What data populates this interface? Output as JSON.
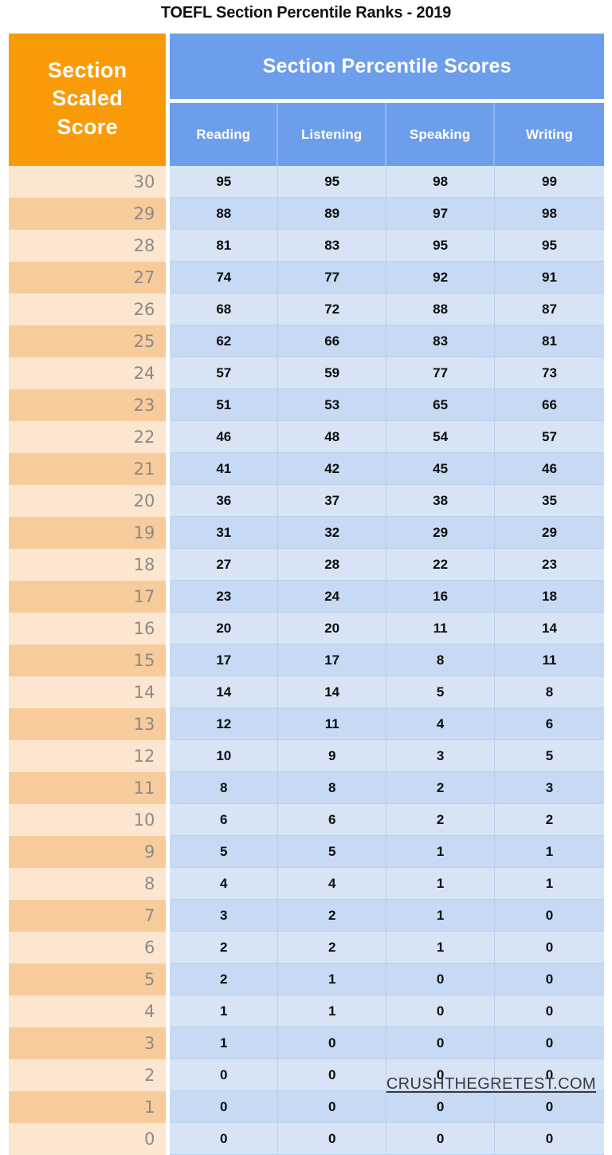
{
  "title": "TOEFL Section Percentile Ranks - 2019",
  "header": {
    "scaled_label": "Section Scaled Score",
    "scaled_line1": "Section",
    "scaled_line2": "Scaled",
    "scaled_line3": "Score",
    "group_label": "Section Percentile Scores",
    "columns": [
      "Reading",
      "Listening",
      "Speaking",
      "Writing"
    ]
  },
  "footer": {
    "watermark": "CRUSHTHEGRETEST.COM"
  },
  "colors": {
    "orange_header": "#F99B08",
    "blue_header": "#6D9EEB",
    "orange_band_light": "#FCE6CF",
    "orange_band_dark": "#F8CB9C",
    "blue_band_light": "#D6E4F5",
    "blue_band_dark": "#C7D9F3",
    "title_text": "#111111",
    "scaled_text": "#8A8A8A",
    "score_text": "#0D0D0D"
  },
  "chart_data": {
    "type": "table",
    "title": "TOEFL Section Percentile Ranks - 2019",
    "xlabel": "Section Scaled Score",
    "ylabel": "Section Percentile Scores",
    "categories": [
      "Reading",
      "Listening",
      "Speaking",
      "Writing"
    ],
    "x": [
      30,
      29,
      28,
      27,
      26,
      25,
      24,
      23,
      22,
      21,
      20,
      19,
      18,
      17,
      16,
      15,
      14,
      13,
      12,
      11,
      10,
      9,
      8,
      7,
      6,
      5,
      4,
      3,
      2,
      1,
      0
    ],
    "series": [
      {
        "name": "Reading",
        "values": [
          95,
          88,
          81,
          74,
          68,
          62,
          57,
          51,
          46,
          41,
          36,
          31,
          27,
          23,
          20,
          17,
          14,
          12,
          10,
          8,
          6,
          5,
          4,
          3,
          2,
          2,
          1,
          1,
          0,
          0,
          0
        ]
      },
      {
        "name": "Listening",
        "values": [
          95,
          89,
          83,
          77,
          72,
          66,
          59,
          53,
          48,
          42,
          37,
          32,
          28,
          24,
          20,
          17,
          14,
          11,
          9,
          8,
          6,
          5,
          4,
          2,
          2,
          1,
          1,
          0,
          0,
          0,
          0
        ]
      },
      {
        "name": "Speaking",
        "values": [
          98,
          97,
          95,
          92,
          88,
          83,
          77,
          65,
          54,
          45,
          38,
          29,
          22,
          16,
          11,
          8,
          5,
          4,
          3,
          2,
          2,
          1,
          1,
          1,
          1,
          0,
          0,
          0,
          0,
          0,
          0
        ]
      },
      {
        "name": "Writing",
        "values": [
          99,
          98,
          95,
          91,
          87,
          81,
          73,
          66,
          57,
          46,
          35,
          29,
          23,
          18,
          14,
          11,
          8,
          6,
          5,
          3,
          2,
          1,
          1,
          0,
          0,
          0,
          0,
          0,
          0,
          0,
          0
        ]
      }
    ],
    "ylim": [
      0,
      100
    ],
    "grid": true,
    "legend": "top"
  },
  "rows": [
    {
      "scaled": "30",
      "reading": "95",
      "listening": "95",
      "speaking": "98",
      "writing": "99"
    },
    {
      "scaled": "29",
      "reading": "88",
      "listening": "89",
      "speaking": "97",
      "writing": "98"
    },
    {
      "scaled": "28",
      "reading": "81",
      "listening": "83",
      "speaking": "95",
      "writing": "95"
    },
    {
      "scaled": "27",
      "reading": "74",
      "listening": "77",
      "speaking": "92",
      "writing": "91"
    },
    {
      "scaled": "26",
      "reading": "68",
      "listening": "72",
      "speaking": "88",
      "writing": "87"
    },
    {
      "scaled": "25",
      "reading": "62",
      "listening": "66",
      "speaking": "83",
      "writing": "81"
    },
    {
      "scaled": "24",
      "reading": "57",
      "listening": "59",
      "speaking": "77",
      "writing": "73"
    },
    {
      "scaled": "23",
      "reading": "51",
      "listening": "53",
      "speaking": "65",
      "writing": "66"
    },
    {
      "scaled": "22",
      "reading": "46",
      "listening": "48",
      "speaking": "54",
      "writing": "57"
    },
    {
      "scaled": "21",
      "reading": "41",
      "listening": "42",
      "speaking": "45",
      "writing": "46"
    },
    {
      "scaled": "20",
      "reading": "36",
      "listening": "37",
      "speaking": "38",
      "writing": "35"
    },
    {
      "scaled": "19",
      "reading": "31",
      "listening": "32",
      "speaking": "29",
      "writing": "29"
    },
    {
      "scaled": "18",
      "reading": "27",
      "listening": "28",
      "speaking": "22",
      "writing": "23"
    },
    {
      "scaled": "17",
      "reading": "23",
      "listening": "24",
      "speaking": "16",
      "writing": "18"
    },
    {
      "scaled": "16",
      "reading": "20",
      "listening": "20",
      "speaking": "11",
      "writing": "14"
    },
    {
      "scaled": "15",
      "reading": "17",
      "listening": "17",
      "speaking": "8",
      "writing": "11"
    },
    {
      "scaled": "14",
      "reading": "14",
      "listening": "14",
      "speaking": "5",
      "writing": "8"
    },
    {
      "scaled": "13",
      "reading": "12",
      "listening": "11",
      "speaking": "4",
      "writing": "6"
    },
    {
      "scaled": "12",
      "reading": "10",
      "listening": "9",
      "speaking": "3",
      "writing": "5"
    },
    {
      "scaled": "11",
      "reading": "8",
      "listening": "8",
      "speaking": "2",
      "writing": "3"
    },
    {
      "scaled": "10",
      "reading": "6",
      "listening": "6",
      "speaking": "2",
      "writing": "2"
    },
    {
      "scaled": "9",
      "reading": "5",
      "listening": "5",
      "speaking": "1",
      "writing": "1"
    },
    {
      "scaled": "8",
      "reading": "4",
      "listening": "4",
      "speaking": "1",
      "writing": "1"
    },
    {
      "scaled": "7",
      "reading": "3",
      "listening": "2",
      "speaking": "1",
      "writing": "0"
    },
    {
      "scaled": "6",
      "reading": "2",
      "listening": "2",
      "speaking": "1",
      "writing": "0"
    },
    {
      "scaled": "5",
      "reading": "2",
      "listening": "1",
      "speaking": "0",
      "writing": "0"
    },
    {
      "scaled": "4",
      "reading": "1",
      "listening": "1",
      "speaking": "0",
      "writing": "0"
    },
    {
      "scaled": "3",
      "reading": "1",
      "listening": "0",
      "speaking": "0",
      "writing": "0"
    },
    {
      "scaled": "2",
      "reading": "0",
      "listening": "0",
      "speaking": "0",
      "writing": "0"
    },
    {
      "scaled": "1",
      "reading": "0",
      "listening": "0",
      "speaking": "0",
      "writing": "0"
    },
    {
      "scaled": "0",
      "reading": "0",
      "listening": "0",
      "speaking": "0",
      "writing": "0"
    }
  ]
}
